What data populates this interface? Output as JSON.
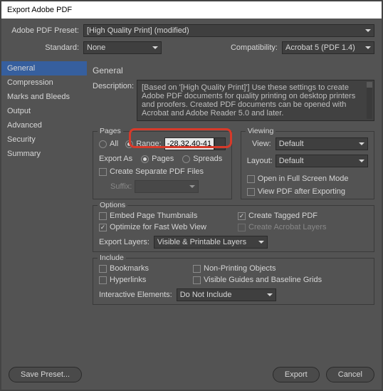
{
  "window": {
    "title": "Export Adobe PDF"
  },
  "preset": {
    "label": "Adobe PDF Preset:",
    "value": "[High Quality Print] (modified)"
  },
  "standard": {
    "label": "Standard:",
    "value": "None"
  },
  "compat": {
    "label": "Compatibility:",
    "value": "Acrobat 5 (PDF 1.4)"
  },
  "sidebar": {
    "items": [
      {
        "label": "General"
      },
      {
        "label": "Compression"
      },
      {
        "label": "Marks and Bleeds"
      },
      {
        "label": "Output"
      },
      {
        "label": "Advanced"
      },
      {
        "label": "Security"
      },
      {
        "label": "Summary"
      }
    ]
  },
  "general": {
    "title": "General",
    "desc_label": "Description:",
    "desc_text": "[Based on '[High Quality Print]'] Use these settings to create Adobe PDF documents for quality printing on desktop printers and proofers. Created PDF documents can be opened with Acrobat and Adobe Reader 5.0 and later."
  },
  "pages": {
    "legend": "Pages",
    "all": "All",
    "range_label": "Range:",
    "range_value": "-28,32,40-41",
    "export_as": "Export As",
    "pages_opt": "Pages",
    "spreads_opt": "Spreads",
    "separate": "Create Separate PDF Files",
    "suffix": "Suffix:"
  },
  "viewing": {
    "legend": "Viewing",
    "view_label": "View:",
    "view_value": "Default",
    "layout_label": "Layout:",
    "layout_value": "Default",
    "fullscreen": "Open in Full Screen Mode",
    "after": "View PDF after Exporting"
  },
  "options": {
    "legend": "Options",
    "thumb": "Embed Page Thumbnails",
    "tagged": "Create Tagged PDF",
    "fastweb": "Optimize for Fast Web View",
    "acrolayers": "Create Acrobat Layers",
    "exportlayers_label": "Export Layers:",
    "exportlayers_value": "Visible & Printable Layers"
  },
  "include": {
    "legend": "Include",
    "bookmarks": "Bookmarks",
    "nonprint": "Non-Printing Objects",
    "hyperlinks": "Hyperlinks",
    "guides": "Visible Guides and Baseline Grids",
    "interactive_label": "Interactive Elements:",
    "interactive_value": "Do Not Include"
  },
  "footer": {
    "save_preset": "Save Preset...",
    "export": "Export",
    "cancel": "Cancel"
  }
}
